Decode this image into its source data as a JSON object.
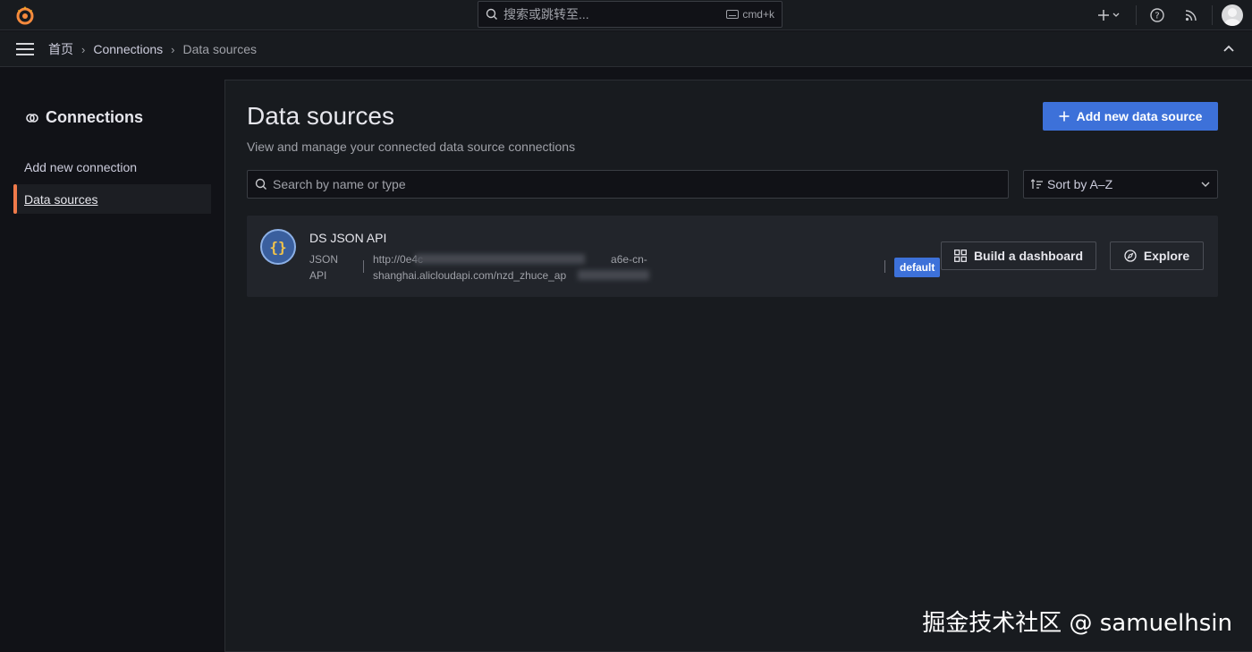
{
  "topbar": {
    "search_placeholder": "搜索或跳转至...",
    "search_shortcut": "cmd+k"
  },
  "breadcrumb": {
    "items": [
      "首页",
      "Connections",
      "Data sources"
    ]
  },
  "sidebar": {
    "title": "Connections",
    "items": [
      {
        "label": "Add new connection",
        "active": false
      },
      {
        "label": "Data sources",
        "active": true
      }
    ]
  },
  "main": {
    "title": "Data sources",
    "subtitle": "View and manage your connected data source connections",
    "add_button": "Add new data source",
    "search_placeholder": "Search by name or type",
    "sort_label": "Sort by A–Z"
  },
  "datasources": [
    {
      "name": "DS JSON API",
      "type_line1": "JSON",
      "type_line2": "API",
      "url_line1": "http://0e4c",
      "url_line1_end": "a6e-cn-",
      "url_line2": "shanghai.alicloudapi.com/nzd_zhuce_ap",
      "badge": "default",
      "build_button": "Build a dashboard",
      "explore_button": "Explore"
    }
  ],
  "watermark": "掘金技术社区 @ samuelhsin",
  "colors": {
    "accent": "#3d71d9",
    "active_indicator": "#f07a4a",
    "background": "#111217",
    "panel": "#181b1f"
  }
}
